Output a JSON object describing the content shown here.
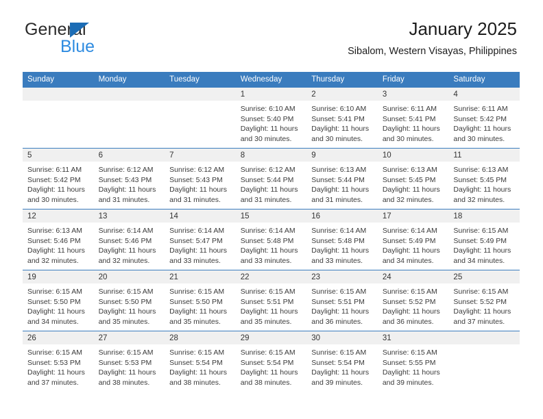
{
  "brand": {
    "word_one": "General",
    "word_two": "Blue",
    "accent_color": "#1b6cb5",
    "blue_text_color": "#2e8be0",
    "triangle_icon": "triangle-icon"
  },
  "header": {
    "title": "January 2025",
    "subtitle": "Sibalom, Western Visayas, Philippines",
    "header_bg_color": "#3a7cbe",
    "daynum_bg_color": "#f0f0f0"
  },
  "weekdays": [
    "Sunday",
    "Monday",
    "Tuesday",
    "Wednesday",
    "Thursday",
    "Friday",
    "Saturday"
  ],
  "labels": {
    "sunrise_prefix": "Sunrise: ",
    "sunset_prefix": "Sunset: ",
    "daylight_prefix": "Daylight: "
  },
  "weeks": [
    {
      "days": [
        {
          "num": "",
          "empty": true
        },
        {
          "num": "",
          "empty": true
        },
        {
          "num": "",
          "empty": true
        },
        {
          "num": "1",
          "sunrise": "Sunrise: 6:10 AM",
          "sunset": "Sunset: 5:40 PM",
          "daylight": "Daylight: 11 hours and 30 minutes."
        },
        {
          "num": "2",
          "sunrise": "Sunrise: 6:10 AM",
          "sunset": "Sunset: 5:41 PM",
          "daylight": "Daylight: 11 hours and 30 minutes."
        },
        {
          "num": "3",
          "sunrise": "Sunrise: 6:11 AM",
          "sunset": "Sunset: 5:41 PM",
          "daylight": "Daylight: 11 hours and 30 minutes."
        },
        {
          "num": "4",
          "sunrise": "Sunrise: 6:11 AM",
          "sunset": "Sunset: 5:42 PM",
          "daylight": "Daylight: 11 hours and 30 minutes."
        }
      ]
    },
    {
      "days": [
        {
          "num": "5",
          "sunrise": "Sunrise: 6:11 AM",
          "sunset": "Sunset: 5:42 PM",
          "daylight": "Daylight: 11 hours and 30 minutes."
        },
        {
          "num": "6",
          "sunrise": "Sunrise: 6:12 AM",
          "sunset": "Sunset: 5:43 PM",
          "daylight": "Daylight: 11 hours and 31 minutes."
        },
        {
          "num": "7",
          "sunrise": "Sunrise: 6:12 AM",
          "sunset": "Sunset: 5:43 PM",
          "daylight": "Daylight: 11 hours and 31 minutes."
        },
        {
          "num": "8",
          "sunrise": "Sunrise: 6:12 AM",
          "sunset": "Sunset: 5:44 PM",
          "daylight": "Daylight: 11 hours and 31 minutes."
        },
        {
          "num": "9",
          "sunrise": "Sunrise: 6:13 AM",
          "sunset": "Sunset: 5:44 PM",
          "daylight": "Daylight: 11 hours and 31 minutes."
        },
        {
          "num": "10",
          "sunrise": "Sunrise: 6:13 AM",
          "sunset": "Sunset: 5:45 PM",
          "daylight": "Daylight: 11 hours and 32 minutes."
        },
        {
          "num": "11",
          "sunrise": "Sunrise: 6:13 AM",
          "sunset": "Sunset: 5:45 PM",
          "daylight": "Daylight: 11 hours and 32 minutes."
        }
      ]
    },
    {
      "days": [
        {
          "num": "12",
          "sunrise": "Sunrise: 6:13 AM",
          "sunset": "Sunset: 5:46 PM",
          "daylight": "Daylight: 11 hours and 32 minutes."
        },
        {
          "num": "13",
          "sunrise": "Sunrise: 6:14 AM",
          "sunset": "Sunset: 5:46 PM",
          "daylight": "Daylight: 11 hours and 32 minutes."
        },
        {
          "num": "14",
          "sunrise": "Sunrise: 6:14 AM",
          "sunset": "Sunset: 5:47 PM",
          "daylight": "Daylight: 11 hours and 33 minutes."
        },
        {
          "num": "15",
          "sunrise": "Sunrise: 6:14 AM",
          "sunset": "Sunset: 5:48 PM",
          "daylight": "Daylight: 11 hours and 33 minutes."
        },
        {
          "num": "16",
          "sunrise": "Sunrise: 6:14 AM",
          "sunset": "Sunset: 5:48 PM",
          "daylight": "Daylight: 11 hours and 33 minutes."
        },
        {
          "num": "17",
          "sunrise": "Sunrise: 6:14 AM",
          "sunset": "Sunset: 5:49 PM",
          "daylight": "Daylight: 11 hours and 34 minutes."
        },
        {
          "num": "18",
          "sunrise": "Sunrise: 6:15 AM",
          "sunset": "Sunset: 5:49 PM",
          "daylight": "Daylight: 11 hours and 34 minutes."
        }
      ]
    },
    {
      "days": [
        {
          "num": "19",
          "sunrise": "Sunrise: 6:15 AM",
          "sunset": "Sunset: 5:50 PM",
          "daylight": "Daylight: 11 hours and 34 minutes."
        },
        {
          "num": "20",
          "sunrise": "Sunrise: 6:15 AM",
          "sunset": "Sunset: 5:50 PM",
          "daylight": "Daylight: 11 hours and 35 minutes."
        },
        {
          "num": "21",
          "sunrise": "Sunrise: 6:15 AM",
          "sunset": "Sunset: 5:50 PM",
          "daylight": "Daylight: 11 hours and 35 minutes."
        },
        {
          "num": "22",
          "sunrise": "Sunrise: 6:15 AM",
          "sunset": "Sunset: 5:51 PM",
          "daylight": "Daylight: 11 hours and 35 minutes."
        },
        {
          "num": "23",
          "sunrise": "Sunrise: 6:15 AM",
          "sunset": "Sunset: 5:51 PM",
          "daylight": "Daylight: 11 hours and 36 minutes."
        },
        {
          "num": "24",
          "sunrise": "Sunrise: 6:15 AM",
          "sunset": "Sunset: 5:52 PM",
          "daylight": "Daylight: 11 hours and 36 minutes."
        },
        {
          "num": "25",
          "sunrise": "Sunrise: 6:15 AM",
          "sunset": "Sunset: 5:52 PM",
          "daylight": "Daylight: 11 hours and 37 minutes."
        }
      ]
    },
    {
      "days": [
        {
          "num": "26",
          "sunrise": "Sunrise: 6:15 AM",
          "sunset": "Sunset: 5:53 PM",
          "daylight": "Daylight: 11 hours and 37 minutes."
        },
        {
          "num": "27",
          "sunrise": "Sunrise: 6:15 AM",
          "sunset": "Sunset: 5:53 PM",
          "daylight": "Daylight: 11 hours and 38 minutes."
        },
        {
          "num": "28",
          "sunrise": "Sunrise: 6:15 AM",
          "sunset": "Sunset: 5:54 PM",
          "daylight": "Daylight: 11 hours and 38 minutes."
        },
        {
          "num": "29",
          "sunrise": "Sunrise: 6:15 AM",
          "sunset": "Sunset: 5:54 PM",
          "daylight": "Daylight: 11 hours and 38 minutes."
        },
        {
          "num": "30",
          "sunrise": "Sunrise: 6:15 AM",
          "sunset": "Sunset: 5:54 PM",
          "daylight": "Daylight: 11 hours and 39 minutes."
        },
        {
          "num": "31",
          "sunrise": "Sunrise: 6:15 AM",
          "sunset": "Sunset: 5:55 PM",
          "daylight": "Daylight: 11 hours and 39 minutes."
        },
        {
          "num": "",
          "empty": true
        }
      ]
    }
  ]
}
